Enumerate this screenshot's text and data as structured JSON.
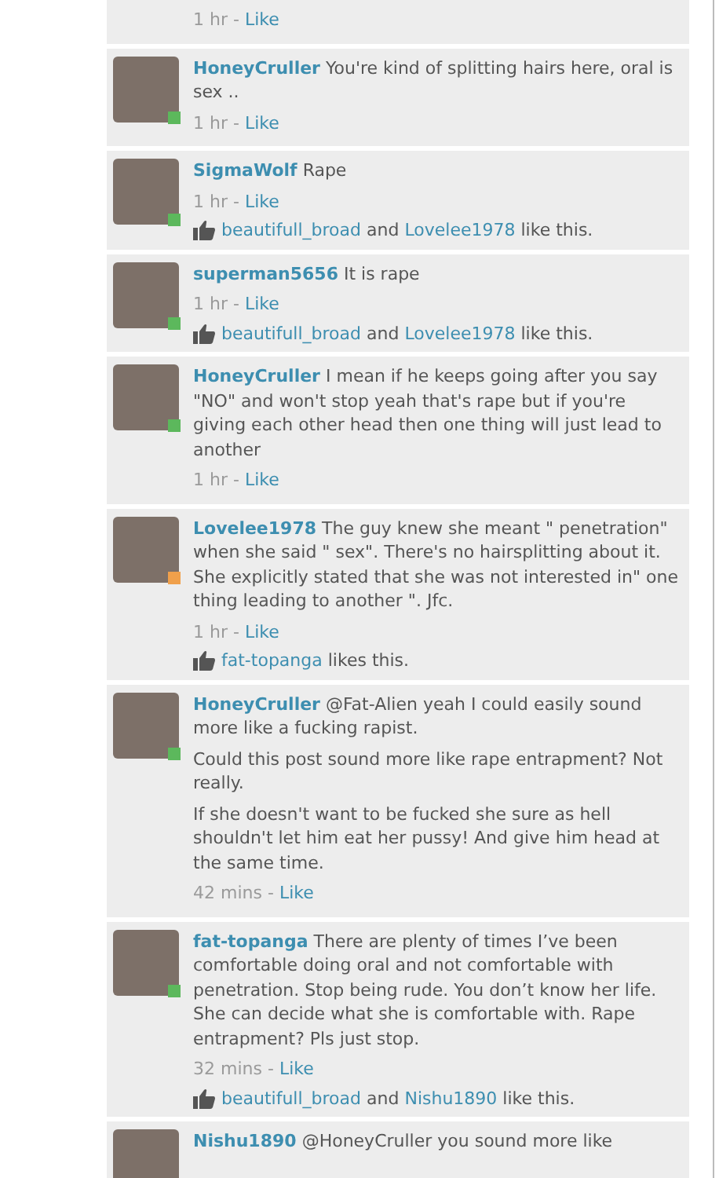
{
  "comments": [
    {
      "time": "1 hr",
      "separator": "-",
      "like_label": "Like"
    },
    {
      "author": "HoneyCruller",
      "paragraphs": [
        "You're kind of splitting hairs here, oral is sex .."
      ],
      "time": "1 hr",
      "separator": "-",
      "like_label": "Like",
      "color": "#5cb85c"
    },
    {
      "author": "SigmaWolf",
      "paragraphs": [
        "Rape"
      ],
      "time": "1 hr",
      "separator": "-",
      "like_label": "Like",
      "color": "#5cb85c",
      "likes": {
        "names": [
          "beautifull_broad",
          "Lovelee1978"
        ],
        "joiner": "and",
        "suffix": "like this."
      }
    },
    {
      "author": "superman5656",
      "paragraphs": [
        "It is rape"
      ],
      "time": "1 hr",
      "separator": "-",
      "like_label": "Like",
      "color": "#5cb85c",
      "likes": {
        "names": [
          "beautifull_broad",
          "Lovelee1978"
        ],
        "joiner": "and",
        "suffix": "like this."
      }
    },
    {
      "author": "HoneyCruller",
      "paragraphs": [
        "I mean if he keeps going after you say \"NO\" and won't stop yeah that's rape but if you're giving each other head then one thing will just lead to another"
      ],
      "time": "1 hr",
      "separator": "-",
      "like_label": "Like",
      "color": "#5cb85c"
    },
    {
      "author": "Lovelee1978",
      "paragraphs": [
        "The guy knew she meant \" penetration\" when she said \" sex\". There's no hairsplitting about it. She explicitly stated that she was not interested in\" one thing leading to another \". Jfc."
      ],
      "time": "1 hr",
      "separator": "-",
      "like_label": "Like",
      "color": "#f0a04b",
      "likes": {
        "names": [
          "fat-topanga"
        ],
        "suffix": "likes this."
      }
    },
    {
      "author": "HoneyCruller",
      "paragraphs": [
        "@Fat-Alien yeah I could easily sound more like a fucking rapist.",
        "Could this post sound more like rape entrapment? Not really.",
        "If she doesn't want to be fucked she sure as hell shouldn't let him eat her pussy! And give him head at the same time."
      ],
      "time": "42 mins",
      "separator": "-",
      "like_label": "Like",
      "color": "#5cb85c"
    },
    {
      "author": "fat-topanga",
      "paragraphs": [
        "There are plenty of times I’ve been comfortable doing oral and not comfortable with penetration. Stop being rude. You don’t know her life. She can decide what she is comfortable with. Rape entrapment? Pls just stop."
      ],
      "time": "32 mins",
      "separator": "-",
      "like_label": "Like",
      "color": "#5cb85c",
      "likes": {
        "names": [
          "beautifull_broad",
          "Nishu1890"
        ],
        "joiner": "and",
        "suffix": "like this."
      }
    },
    {
      "author": "Nishu1890",
      "paragraphs": [
        "@HoneyCruller you sound more like"
      ]
    }
  ]
}
